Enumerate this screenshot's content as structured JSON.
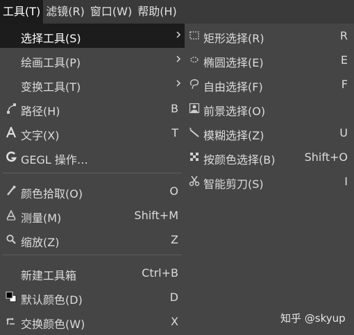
{
  "menubar": {
    "items": [
      "工具(T)",
      "滤镜(R)",
      "窗口(W)",
      "帮助(H)"
    ]
  },
  "tools_menu": {
    "items": [
      {
        "label": "选择工具(S)",
        "accel": "",
        "submenu": true,
        "icon": "",
        "highlight": true
      },
      {
        "label": "绘画工具(P)",
        "accel": "",
        "submenu": true,
        "icon": ""
      },
      {
        "label": "变换工具(T)",
        "accel": "",
        "submenu": true,
        "icon": ""
      },
      {
        "label": "路径(H)",
        "accel": "B",
        "icon": "paths-icon"
      },
      {
        "label": "文字(X)",
        "accel": "T",
        "icon": "text-icon"
      },
      {
        "label": "GEGL 操作…",
        "accel": "",
        "icon": "gegl-icon"
      },
      {
        "label": "颜色拾取(O)",
        "accel": "O",
        "icon": "color-picker-icon"
      },
      {
        "label": "测量(M)",
        "accel": "Shift+M",
        "icon": "measure-icon"
      },
      {
        "label": "缩放(Z)",
        "accel": "Z",
        "icon": "zoom-icon"
      },
      {
        "label": "新建工具箱",
        "accel": "Ctrl+B",
        "icon": ""
      },
      {
        "label": "默认颜色(D)",
        "accel": "D",
        "icon": "default-colors-icon"
      },
      {
        "label": "交换颜色(W)",
        "accel": "X",
        "icon": "swap-colors-icon"
      }
    ]
  },
  "selection_submenu": {
    "items": [
      {
        "label": "矩形选择(R)",
        "accel": "R",
        "icon": "rect-select-icon"
      },
      {
        "label": "椭圆选择(E)",
        "accel": "E",
        "icon": "ellipse-select-icon"
      },
      {
        "label": "自由选择(F)",
        "accel": "F",
        "icon": "free-select-icon"
      },
      {
        "label": "前景选择(O)",
        "accel": "",
        "icon": "foreground-select-icon"
      },
      {
        "label": "模糊选择(Z)",
        "accel": "U",
        "icon": "fuzzy-select-icon"
      },
      {
        "label": "按颜色选择(B)",
        "accel": "Shift+O",
        "icon": "select-by-color-icon"
      },
      {
        "label": "智能剪刀(S)",
        "accel": "I",
        "icon": "scissors-icon"
      }
    ]
  },
  "watermark": "知乎 @skyup",
  "colors": {
    "menu_bg": "#454545",
    "menubar_bg": "#3a3a3a",
    "highlight_bg": "#1c1c1c",
    "text": "#dcdcdc"
  }
}
